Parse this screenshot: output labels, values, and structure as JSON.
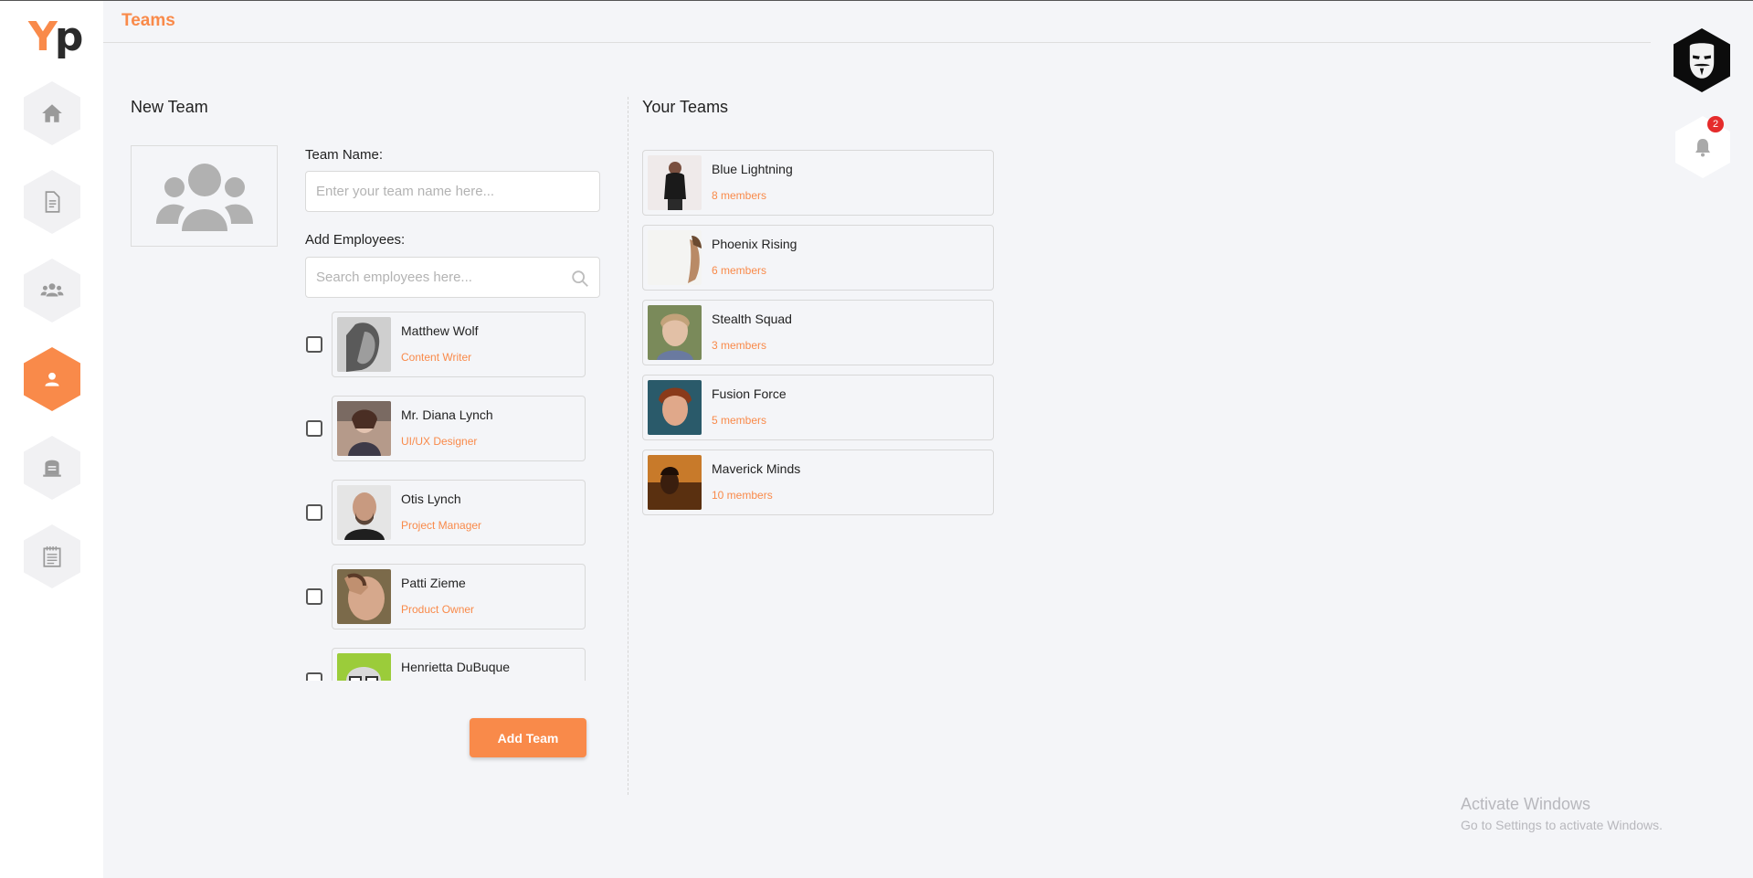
{
  "brand": {
    "logo_y": "Y",
    "logo_p": "p"
  },
  "colors": {
    "accent": "#f98a4a",
    "badge": "#e52b2b",
    "background": "#f4f5f8"
  },
  "sidebar": {
    "items": [
      {
        "name": "home",
        "icon": "home-icon"
      },
      {
        "name": "documents",
        "icon": "document-icon"
      },
      {
        "name": "groups",
        "icon": "users-icon"
      },
      {
        "name": "teams",
        "icon": "user-icon",
        "active": true
      },
      {
        "name": "id",
        "icon": "id-badge-icon"
      },
      {
        "name": "notes",
        "icon": "notepad-icon"
      }
    ]
  },
  "header": {
    "title": "Teams"
  },
  "notifications": {
    "count": "2"
  },
  "new_team": {
    "title": "New Team",
    "team_name_label": "Team Name:",
    "team_name_placeholder": "Enter your team name here...",
    "add_employees_label": "Add Employees:",
    "search_placeholder": "Search employees here...",
    "add_button": "Add Team",
    "employees": [
      {
        "name": "Matthew Wolf",
        "role": "Content Writer",
        "checked": false
      },
      {
        "name": "Mr. Diana Lynch",
        "role": "UI/UX Designer",
        "checked": false
      },
      {
        "name": "Otis Lynch",
        "role": "Project Manager",
        "checked": false
      },
      {
        "name": "Patti Zieme",
        "role": "Product Owner",
        "checked": false
      },
      {
        "name": "Henrietta DuBuque",
        "role": "",
        "checked": false
      }
    ]
  },
  "your_teams": {
    "title": "Your Teams",
    "teams": [
      {
        "name": "Blue Lightning",
        "members": "8 members"
      },
      {
        "name": "Phoenix Rising",
        "members": "6 members"
      },
      {
        "name": "Stealth Squad",
        "members": "3 members"
      },
      {
        "name": "Fusion Force",
        "members": "5 members"
      },
      {
        "name": "Maverick Minds",
        "members": "10 members"
      }
    ]
  },
  "watermark": {
    "line1": "Activate Windows",
    "line2": "Go to Settings to activate Windows."
  }
}
